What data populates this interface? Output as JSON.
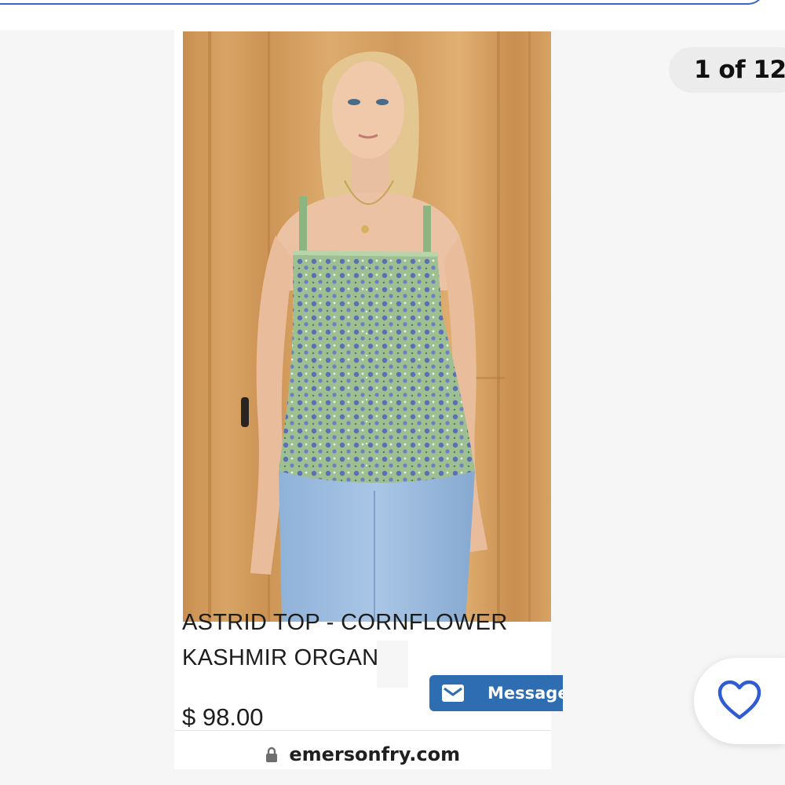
{
  "gallery": {
    "counter": "1 of 12"
  },
  "product": {
    "title_line1": "ASTRID TOP - CORNFLOWER",
    "title_line2": "KASHMIR ORGANIC",
    "price": "$ 98.00",
    "message_button_label": "Message",
    "image_alt": "Model wearing green floral cami top and light blue jeans in front of wooden door"
  },
  "browser": {
    "url": "emersonfry.com"
  },
  "icons": {
    "lock": "lock-icon",
    "envelope": "envelope-icon",
    "favorite": "heart-outline-icon"
  },
  "colors": {
    "accent": "#3a66c4",
    "button": "#2e6db2",
    "heart": "#2f5bd3"
  }
}
